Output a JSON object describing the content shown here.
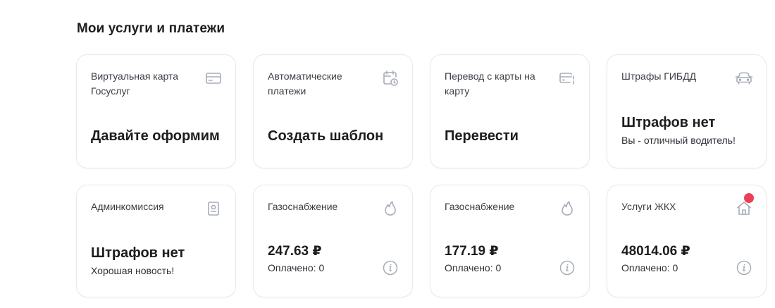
{
  "section": {
    "title": "Мои услуги и платежи"
  },
  "colors": {
    "icon": "#a7adb8",
    "notification": "#ee3f58",
    "border": "#e6e9ee"
  },
  "cards": [
    {
      "title": "Виртуальная карта Госуслуг",
      "icon": "credit-card-icon",
      "main": "Давайте оформим"
    },
    {
      "title": "Автоматические платежи",
      "icon": "calendar-clock-icon",
      "main": "Создать шаблон"
    },
    {
      "title": "Перевод с карты на карту",
      "icon": "card-transfer-icon",
      "main": "Перевести"
    },
    {
      "title": "Штрафы ГИБДД",
      "icon": "car-icon",
      "main": "Штрафов нет",
      "sub": "Вы - отличный водитель!"
    },
    {
      "title": "Админкомиссия",
      "icon": "document-badge-icon",
      "main": "Штрафов нет",
      "sub": "Хорошая новость!"
    },
    {
      "title": "Газоснабжение",
      "icon": "flame-icon",
      "main": "247.63 ₽",
      "sub": "Оплачено: 0",
      "info_icon": "info-icon"
    },
    {
      "title": "Газоснабжение",
      "icon": "flame-icon",
      "main": "177.19 ₽",
      "sub": "Оплачено: 0",
      "info_icon": "info-icon"
    },
    {
      "title": "Услуги ЖКХ",
      "icon": "house-icon",
      "main": "48014.06 ₽",
      "sub": "Оплачено: 0",
      "info_icon": "info-icon",
      "has_notification": true
    }
  ]
}
